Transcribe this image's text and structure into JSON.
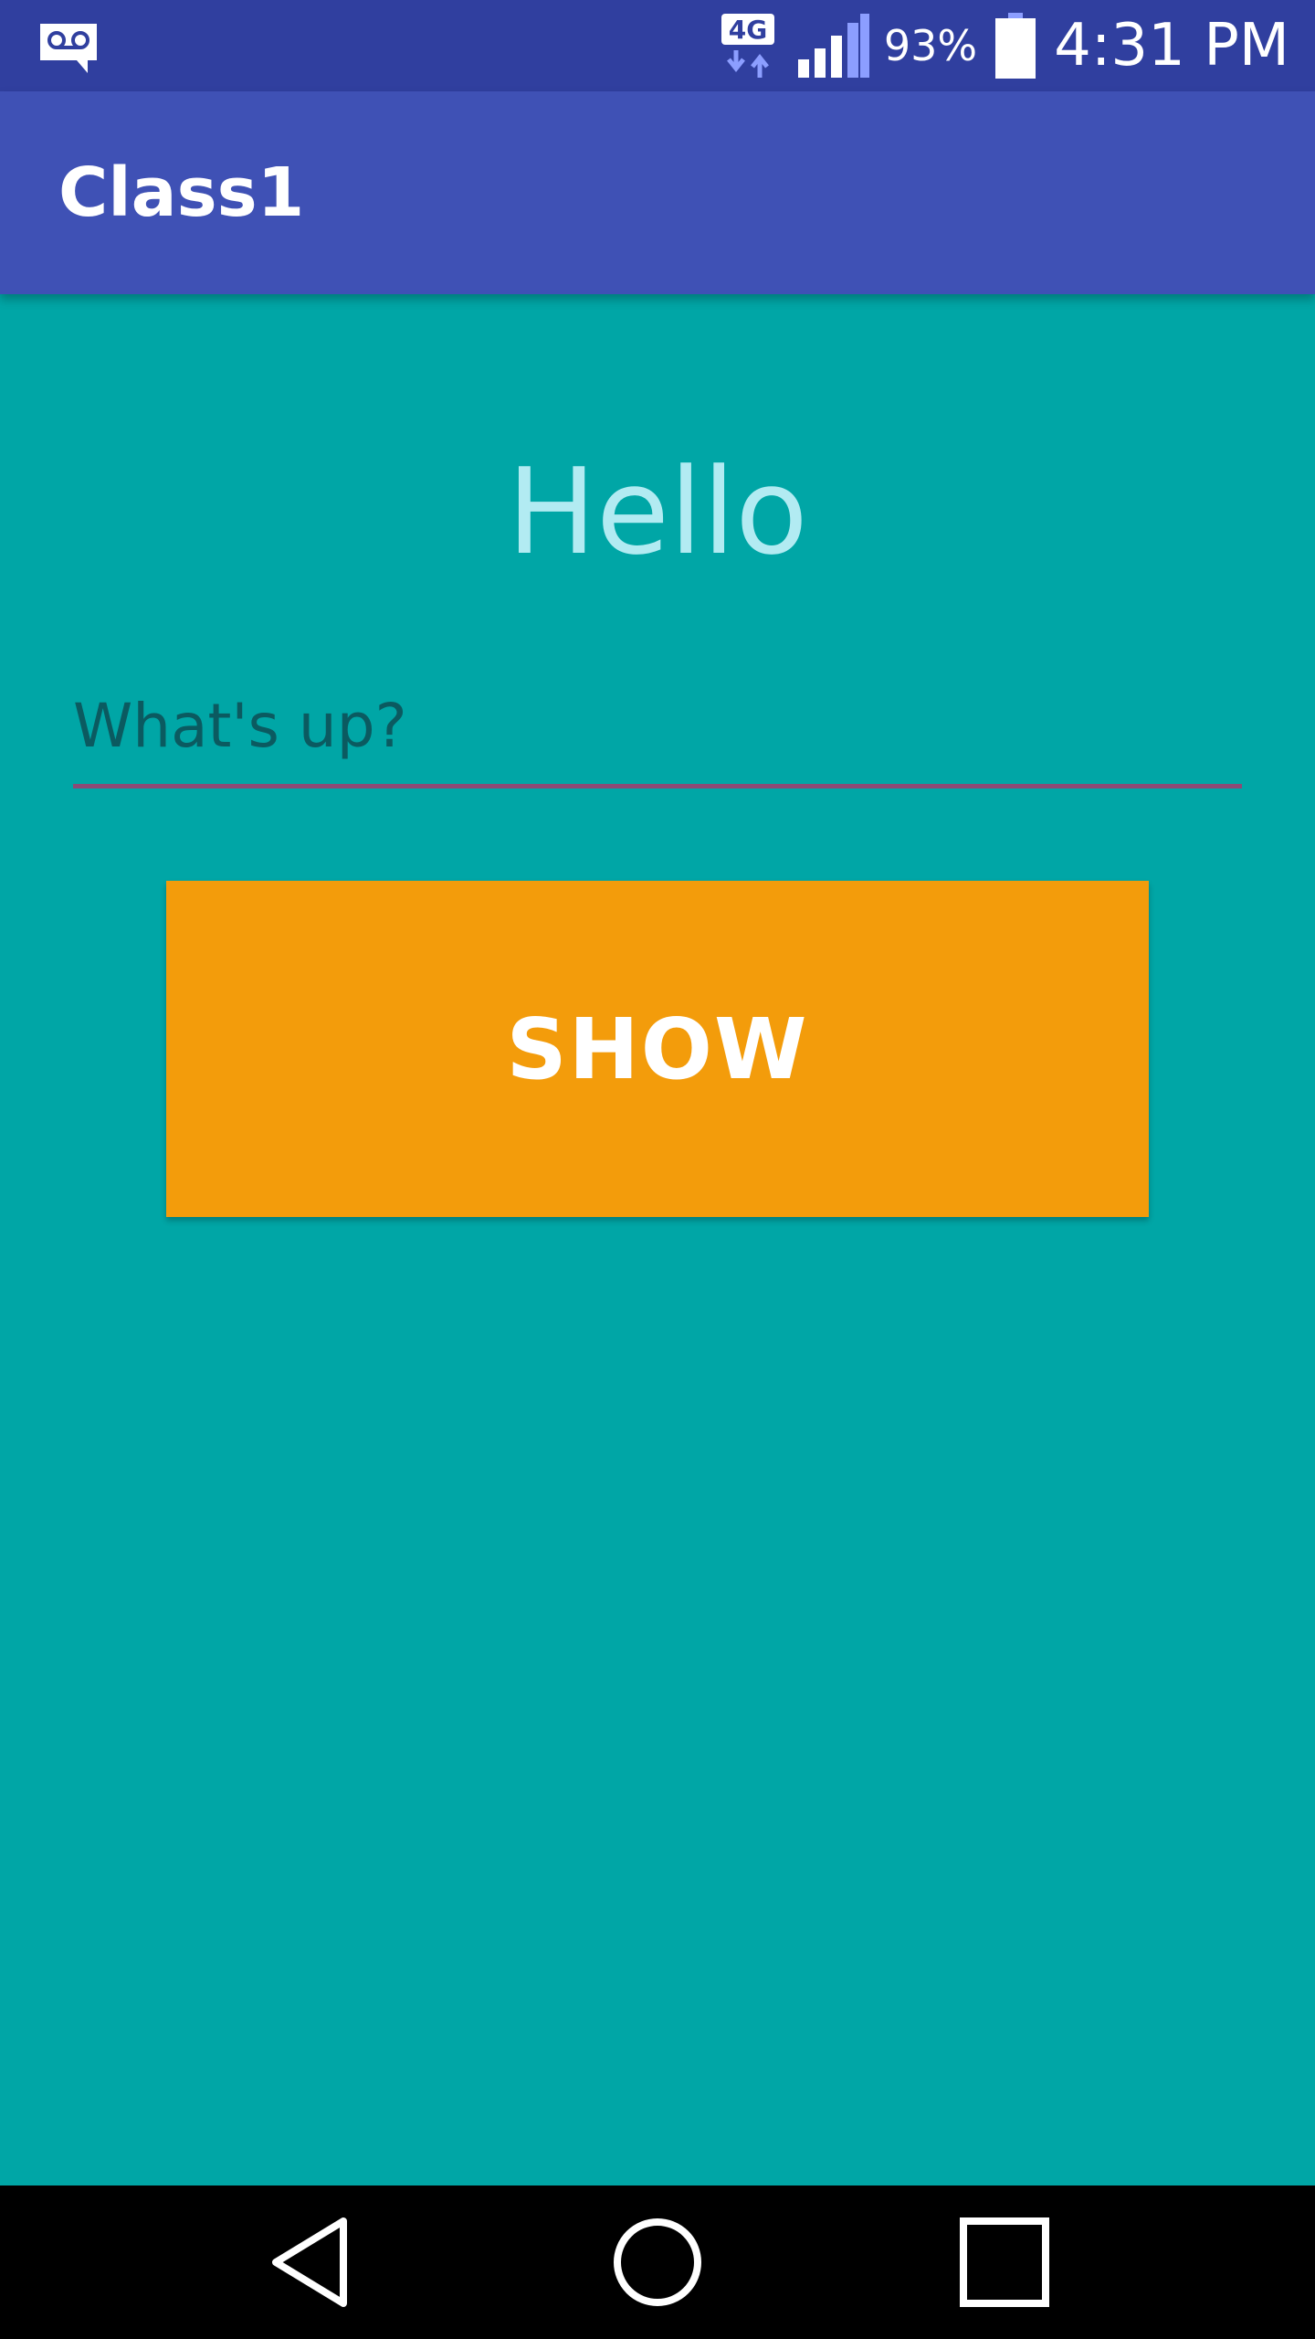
{
  "status_bar": {
    "network_label": "4G",
    "battery_percent": "93%",
    "time": "4:31 PM",
    "icons": {
      "voicemail": "voicemail-icon",
      "network": "network-4g-icon",
      "signal": "signal-icon",
      "battery": "battery-icon"
    }
  },
  "app_bar": {
    "title": "Class1"
  },
  "main": {
    "greeting": "Hello",
    "input": {
      "placeholder": "What's up?",
      "value": ""
    },
    "show_button_label": "SHOW"
  },
  "nav_bar": {
    "icons": {
      "back": "back-icon",
      "home": "home-icon",
      "recents": "recents-icon"
    }
  },
  "colors": {
    "status_bar": "#303f9f",
    "app_bar": "#3f51b5",
    "background": "#00a6a6",
    "greeting_text": "#b2ebf2",
    "button": "#f39c0b",
    "input_underline": "#8b4a76",
    "nav_bar": "#000000"
  }
}
